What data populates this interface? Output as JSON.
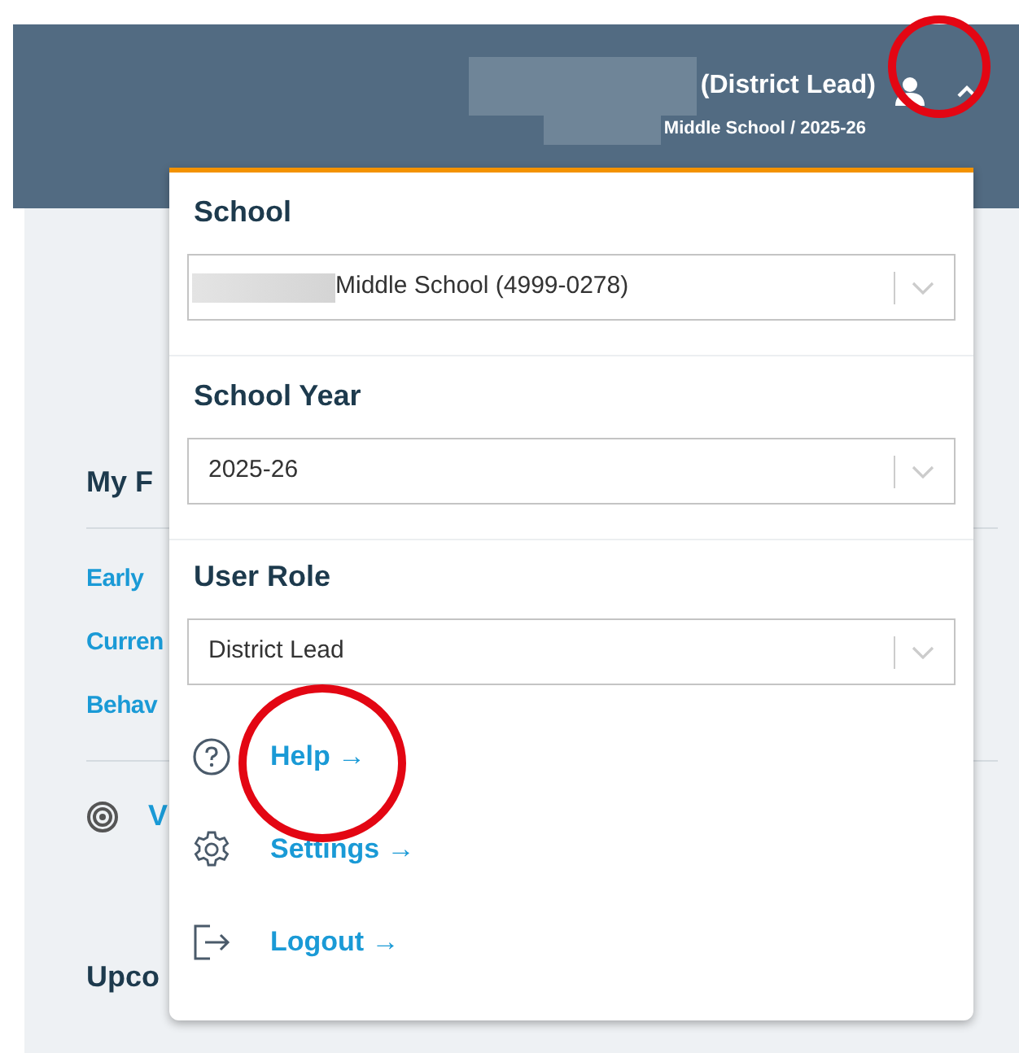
{
  "header": {
    "user_role": "(District Lead)",
    "school_line": "Middle School / 2025-26"
  },
  "page": {
    "heading": "My F",
    "links": [
      "Early",
      "Curren",
      "Behav"
    ],
    "item": "V",
    "heading_2": "Upco"
  },
  "menu": {
    "fields": [
      {
        "label": "School",
        "value": "Middle School (4999-0278)",
        "redacted_prefix": true
      },
      {
        "label": "School Year",
        "value": "2025-26",
        "redacted_prefix": false
      },
      {
        "label": "User Role",
        "value": "District Lead",
        "redacted_prefix": false
      }
    ],
    "links": [
      {
        "kind": "help",
        "label": "Help →"
      },
      {
        "kind": "settings",
        "label": "Settings →"
      },
      {
        "kind": "logout",
        "label": "Logout →"
      }
    ]
  }
}
